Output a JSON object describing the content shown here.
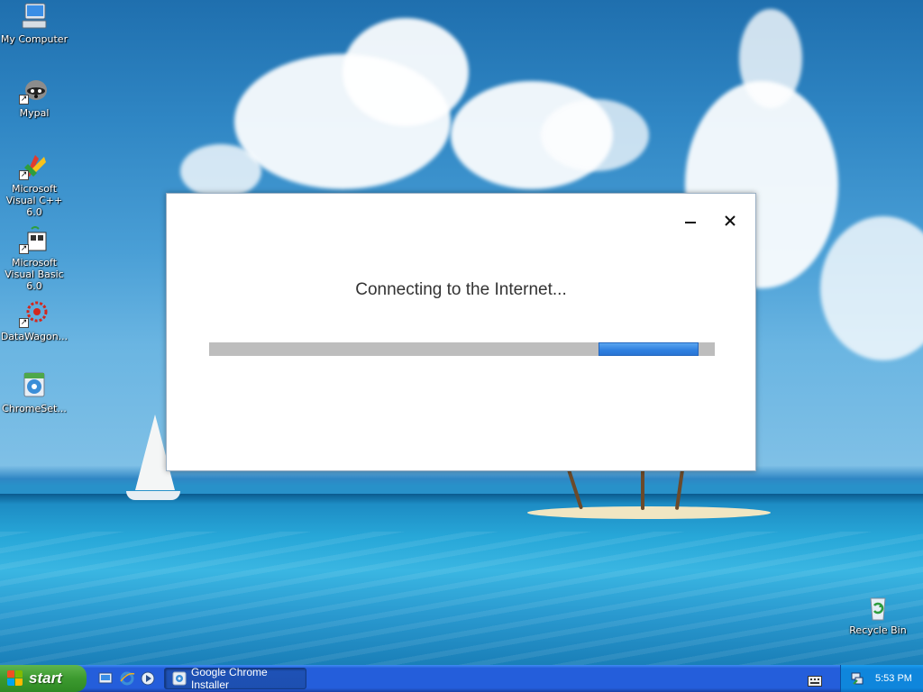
{
  "desktop": {
    "icons": [
      {
        "label": "My Computer",
        "icon": "my-computer-icon"
      },
      {
        "label": "Mypal",
        "icon": "mypal-raccoon-icon"
      },
      {
        "label": "Microsoft Visual C++ 6.0",
        "icon": "visual-cpp-icon"
      },
      {
        "label": "Microsoft Visual Basic 6.0",
        "icon": "visual-basic-icon"
      },
      {
        "label": "DataWagon...",
        "icon": "datawagon-icon"
      },
      {
        "label": "ChromeSet...",
        "icon": "chrome-setup-icon"
      },
      {
        "label": "Recycle Bin",
        "icon": "recycle-bin-icon"
      }
    ]
  },
  "installer": {
    "status": "Connecting to the Internet...",
    "progress": {
      "indeterminate": true,
      "fill_color": "#2f7fe0",
      "track_color": "#bdbdbd"
    },
    "controls": {
      "minimize": "minimize-icon",
      "close": "close-icon"
    }
  },
  "taskbar": {
    "start_label": "start",
    "quick_launch": [
      "show-desktop-icon",
      "internet-explorer-icon",
      "media-player-icon"
    ],
    "tasks": [
      {
        "label": "Google Chrome Installer",
        "icon": "chrome-installer-icon"
      }
    ],
    "tray": {
      "clock": "5:53 PM",
      "icons": [
        "keyboard-icon",
        "network-icon"
      ]
    }
  },
  "colors": {
    "taskbar": "#245edb",
    "start_button": "#3c9a2f",
    "tray": "#0f86dc"
  }
}
